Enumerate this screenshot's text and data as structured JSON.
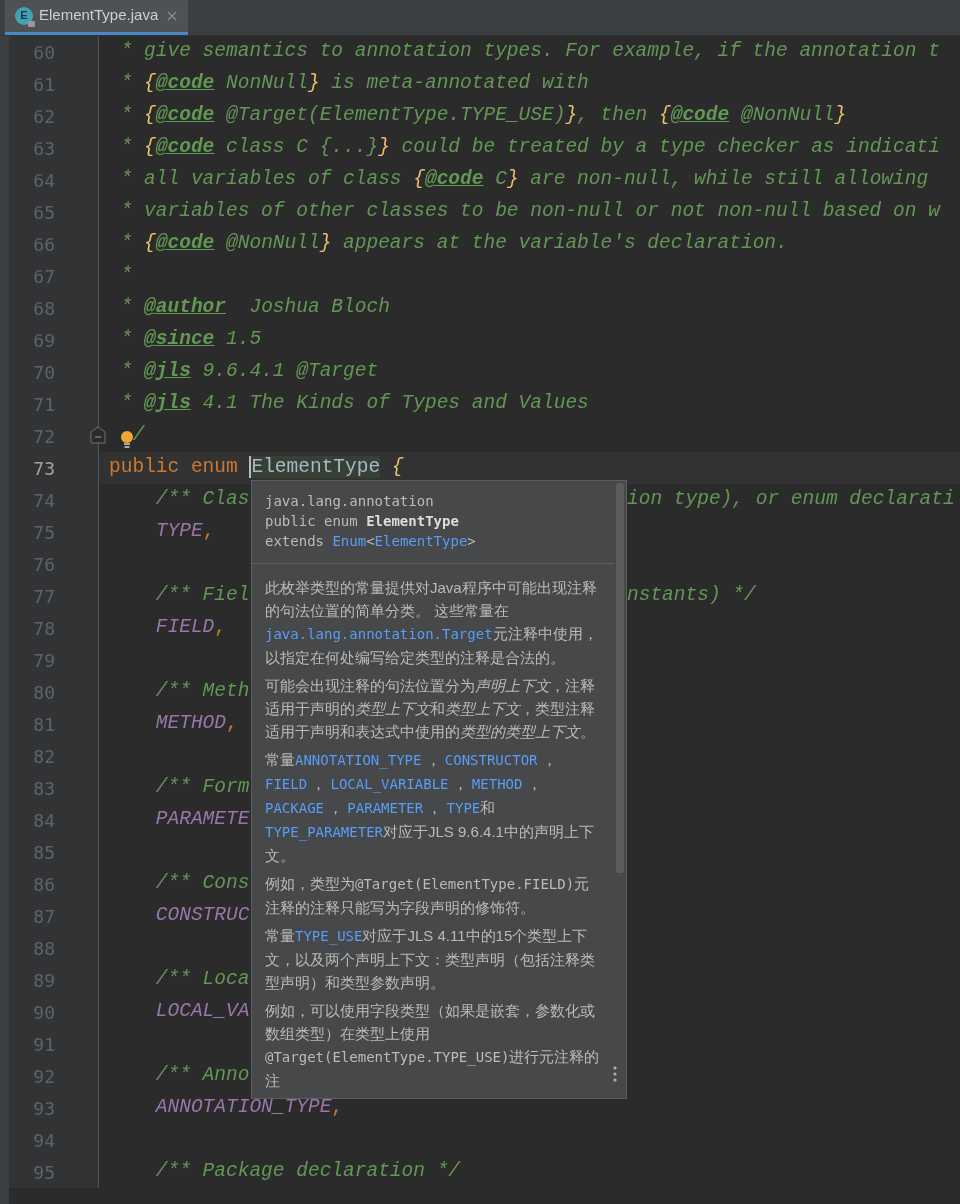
{
  "tabs": [
    {
      "icon_letter": "E",
      "label": "ElementType.java",
      "selected": true
    }
  ],
  "editor": {
    "lines": [
      {
        "number": "60",
        "current": false,
        "left": [
          {
            "kind": "comment",
            "text": " * give semantics to annotation types. For example, if the annotation t"
          }
        ]
      },
      {
        "number": "61",
        "current": false,
        "left": [
          {
            "kind": "comment",
            "text": " * "
          },
          {
            "kind": "brace",
            "text": "{"
          },
          {
            "kind": "tag",
            "text": "@code"
          },
          {
            "kind": "comment",
            "text": " NonNull"
          },
          {
            "kind": "brace",
            "text": "}"
          },
          {
            "kind": "comment",
            "text": " is meta-annotated with"
          }
        ]
      },
      {
        "number": "62",
        "current": false,
        "left": [
          {
            "kind": "comment",
            "text": " * "
          },
          {
            "kind": "brace",
            "text": "{"
          },
          {
            "kind": "tag",
            "text": "@code"
          },
          {
            "kind": "comment",
            "text": " @Target(ElementType.TYPE_USE)"
          },
          {
            "kind": "brace",
            "text": "}"
          },
          {
            "kind": "comment",
            "text": ", then "
          },
          {
            "kind": "brace",
            "text": "{"
          },
          {
            "kind": "tag",
            "text": "@code"
          },
          {
            "kind": "comment",
            "text": " @NonNull"
          },
          {
            "kind": "brace",
            "text": "}"
          }
        ]
      },
      {
        "number": "63",
        "current": false,
        "left": [
          {
            "kind": "comment",
            "text": " * "
          },
          {
            "kind": "brace",
            "text": "{"
          },
          {
            "kind": "tag",
            "text": "@code"
          },
          {
            "kind": "comment",
            "text": " class C {...}"
          },
          {
            "kind": "brace",
            "text": "}"
          },
          {
            "kind": "comment",
            "text": " could be treated by a type checker as indicati"
          }
        ]
      },
      {
        "number": "64",
        "current": false,
        "left": [
          {
            "kind": "comment",
            "text": " * all variables of class "
          },
          {
            "kind": "brace",
            "text": "{"
          },
          {
            "kind": "tag",
            "text": "@code"
          },
          {
            "kind": "comment",
            "text": " C"
          },
          {
            "kind": "brace",
            "text": "}"
          },
          {
            "kind": "comment",
            "text": " are non-null, while still allowing"
          }
        ]
      },
      {
        "number": "65",
        "current": false,
        "left": [
          {
            "kind": "comment",
            "text": " * variables of other classes to be non-null or not non-null based on w"
          }
        ]
      },
      {
        "number": "66",
        "current": false,
        "left": [
          {
            "kind": "comment",
            "text": " * "
          },
          {
            "kind": "brace",
            "text": "{"
          },
          {
            "kind": "tag",
            "text": "@code"
          },
          {
            "kind": "comment",
            "text": " @NonNull"
          },
          {
            "kind": "brace",
            "text": "}"
          },
          {
            "kind": "comment",
            "text": " appears at the variable's declaration."
          }
        ]
      },
      {
        "number": "67",
        "current": false,
        "left": [
          {
            "kind": "comment",
            "text": " *"
          }
        ]
      },
      {
        "number": "68",
        "current": false,
        "left": [
          {
            "kind": "comment",
            "text": " * "
          },
          {
            "kind": "tag",
            "text": "@author"
          },
          {
            "kind": "comment",
            "text": "  Joshua Bloch"
          }
        ]
      },
      {
        "number": "69",
        "current": false,
        "left": [
          {
            "kind": "comment",
            "text": " * "
          },
          {
            "kind": "tag",
            "text": "@since"
          },
          {
            "kind": "comment",
            "text": " 1.5"
          }
        ]
      },
      {
        "number": "70",
        "current": false,
        "left": [
          {
            "kind": "comment",
            "text": " * "
          },
          {
            "kind": "tag",
            "text": "@jls"
          },
          {
            "kind": "comment",
            "text": " 9.6.4.1 @Target"
          }
        ]
      },
      {
        "number": "71",
        "current": false,
        "left": [
          {
            "kind": "comment",
            "text": " * "
          },
          {
            "kind": "tag",
            "text": "@jls"
          },
          {
            "kind": "comment",
            "text": " 4.1 The Kinds of Types and Values"
          }
        ]
      },
      {
        "number": "72",
        "current": false,
        "foldable": true,
        "lightbulb": true,
        "left": [
          {
            "kind": "comment",
            "text": "/"
          }
        ]
      },
      {
        "number": "73",
        "current": true,
        "left": [
          {
            "kind": "keyword",
            "text": "public enum "
          },
          {
            "kind": "identifier",
            "text": "ElementType"
          },
          {
            "kind": "brace",
            "text": " {"
          }
        ]
      },
      {
        "number": "74",
        "current": false,
        "left": [
          {
            "kind": "comment",
            "text": "    /** Clas"
          }
        ],
        "right": [
          {
            "kind": "comment",
            "text": "ion type), or enum declarati"
          }
        ]
      },
      {
        "number": "75",
        "current": false,
        "left": [
          {
            "kind": "constant",
            "text": "    TYPE"
          },
          {
            "kind": "punct",
            "text": ","
          }
        ]
      },
      {
        "number": "76",
        "current": false
      },
      {
        "number": "77",
        "current": false,
        "left": [
          {
            "kind": "comment",
            "text": "    /** Fiel"
          }
        ],
        "right": [
          {
            "kind": "comment",
            "text": "nstants) */"
          }
        ]
      },
      {
        "number": "78",
        "current": false,
        "left": [
          {
            "kind": "constant",
            "text": "    FIELD"
          },
          {
            "kind": "punct",
            "text": ","
          }
        ]
      },
      {
        "number": "79",
        "current": false
      },
      {
        "number": "80",
        "current": false,
        "left": [
          {
            "kind": "comment",
            "text": "    /** Meth"
          }
        ]
      },
      {
        "number": "81",
        "current": false,
        "left": [
          {
            "kind": "constant",
            "text": "    METHOD"
          },
          {
            "kind": "punct",
            "text": ","
          }
        ]
      },
      {
        "number": "82",
        "current": false
      },
      {
        "number": "83",
        "current": false,
        "left": [
          {
            "kind": "comment",
            "text": "    /** Form"
          }
        ]
      },
      {
        "number": "84",
        "current": false,
        "left": [
          {
            "kind": "constant",
            "text": "    PARAMETE"
          }
        ]
      },
      {
        "number": "85",
        "current": false
      },
      {
        "number": "86",
        "current": false,
        "left": [
          {
            "kind": "comment",
            "text": "    /** Cons"
          }
        ]
      },
      {
        "number": "87",
        "current": false,
        "left": [
          {
            "kind": "constant",
            "text": "    CONSTRUC"
          }
        ]
      },
      {
        "number": "88",
        "current": false
      },
      {
        "number": "89",
        "current": false,
        "left": [
          {
            "kind": "comment",
            "text": "    /** Loca"
          }
        ]
      },
      {
        "number": "90",
        "current": false,
        "left": [
          {
            "kind": "constant",
            "text": "    LOCAL_VA"
          }
        ]
      },
      {
        "number": "91",
        "current": false
      },
      {
        "number": "92",
        "current": false,
        "left": [
          {
            "kind": "comment",
            "text": "    /** Anno"
          }
        ]
      },
      {
        "number": "93",
        "current": false,
        "left": [
          {
            "kind": "constant",
            "text": "    ANNOTATION_TYPE"
          },
          {
            "kind": "punct",
            "text": ","
          }
        ]
      },
      {
        "number": "94",
        "current": false
      },
      {
        "number": "95",
        "current": false,
        "left": [
          {
            "kind": "comment",
            "text": "    /** Package declaration */"
          }
        ]
      }
    ]
  },
  "doc_popup": {
    "header": [
      [
        {
          "kind": "plain",
          "text": "java.lang.annotation"
        }
      ],
      [
        {
          "kind": "plain",
          "text": "public enum "
        },
        {
          "kind": "bold",
          "text": "ElementType"
        }
      ],
      [
        {
          "kind": "plain",
          "text": "extends "
        },
        {
          "kind": "link",
          "text": "Enum"
        },
        {
          "kind": "plain",
          "text": "<"
        },
        {
          "kind": "link",
          "text": "ElementType"
        },
        {
          "kind": "plain",
          "text": ">"
        }
      ]
    ],
    "paragraphs": [
      [
        {
          "kind": "text",
          "text": "此枚举类型的常量提供对Java程序中可能出现注释的句法位置的简单分类。 这些常量在"
        },
        {
          "kind": "link",
          "text": "java.lang.annotation.Target"
        },
        {
          "kind": "text",
          "text": "元注释中使用，以指定在何处编写给定类型的注释是合法的。"
        }
      ],
      [
        {
          "kind": "text",
          "text": "可能会出现注释的句法位置分为"
        },
        {
          "kind": "em",
          "text": "声明上下文"
        },
        {
          "kind": "text",
          "text": "，注释适用于声明的"
        },
        {
          "kind": "em",
          "text": "类型上下文"
        },
        {
          "kind": "text",
          "text": "和"
        },
        {
          "kind": "em",
          "text": "类型上下文"
        },
        {
          "kind": "text",
          "text": "，类型注释适用于声明和表达式中使用的"
        },
        {
          "kind": "em",
          "text": "类型的类型上下文"
        },
        {
          "kind": "text",
          "text": "。"
        }
      ],
      [
        {
          "kind": "text",
          "text": "常量"
        },
        {
          "kind": "link",
          "text": "ANNOTATION_TYPE"
        },
        {
          "kind": "text",
          "text": " ， "
        },
        {
          "kind": "link",
          "text": "CONSTRUCTOR"
        },
        {
          "kind": "text",
          "text": " ， "
        },
        {
          "kind": "link",
          "text": "FIELD"
        },
        {
          "kind": "text",
          "text": " ， "
        },
        {
          "kind": "link",
          "text": "LOCAL_VARIABLE"
        },
        {
          "kind": "text",
          "text": " ， "
        },
        {
          "kind": "link",
          "text": "METHOD"
        },
        {
          "kind": "text",
          "text": " ， "
        },
        {
          "kind": "link",
          "text": "PACKAGE"
        },
        {
          "kind": "text",
          "text": " ， "
        },
        {
          "kind": "link",
          "text": "PARAMETER"
        },
        {
          "kind": "text",
          "text": " ， "
        },
        {
          "kind": "link",
          "text": "TYPE"
        },
        {
          "kind": "text",
          "text": "和"
        },
        {
          "kind": "link",
          "text": "TYPE_PARAMETER"
        },
        {
          "kind": "text",
          "text": "对应于JLS 9.6.4.1中的声明上下文。"
        }
      ],
      [
        {
          "kind": "text",
          "text": "例如，类型为"
        },
        {
          "kind": "mono",
          "text": "@Target(ElementType.FIELD)"
        },
        {
          "kind": "text",
          "text": "元注释的注释只能写为字段声明的修饰符。"
        }
      ],
      [
        {
          "kind": "text",
          "text": "常量"
        },
        {
          "kind": "link",
          "text": "TYPE_USE"
        },
        {
          "kind": "text",
          "text": "对应于JLS 4.11中的15个类型上下文，以及两个声明上下文：类型声明（包括注释类型声明）和类型参数声明。"
        }
      ],
      [
        {
          "kind": "text",
          "text": "例如，可以使用字段类型（如果是嵌套，参数化或数组类型）在类型上使用"
        },
        {
          "kind": "mono",
          "text": "@Target(ElementType.TYPE_USE)"
        },
        {
          "kind": "text",
          "text": "进行元注释的注"
        }
      ]
    ]
  }
}
